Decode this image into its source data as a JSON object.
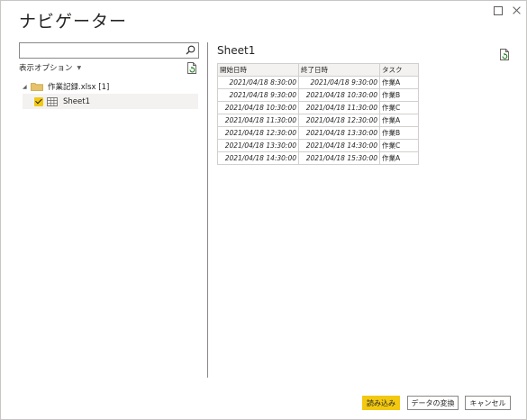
{
  "window": {
    "title": "ナビゲーター"
  },
  "left_pane": {
    "search": {
      "value": "",
      "placeholder": ""
    },
    "display_options_label": "表示オプション",
    "tree": {
      "root_label": "作業記録.xlsx [1]",
      "items": [
        {
          "label": "Sheet1",
          "checked": true,
          "selected": true
        }
      ]
    }
  },
  "preview": {
    "title": "Sheet1",
    "columns": [
      "開始日時",
      "終了日時",
      "タスク"
    ],
    "rows": [
      [
        "2021/04/18 8:30:00",
        "2021/04/18 9:30:00",
        "作業A"
      ],
      [
        "2021/04/18 9:30:00",
        "2021/04/18 10:30:00",
        "作業B"
      ],
      [
        "2021/04/18 10:30:00",
        "2021/04/18 11:30:00",
        "作業C"
      ],
      [
        "2021/04/18 11:30:00",
        "2021/04/18 12:30:00",
        "作業A"
      ],
      [
        "2021/04/18 12:30:00",
        "2021/04/18 13:30:00",
        "作業B"
      ],
      [
        "2021/04/18 13:30:00",
        "2021/04/18 14:30:00",
        "作業C"
      ],
      [
        "2021/04/18 14:30:00",
        "2021/04/18 15:30:00",
        "作業A"
      ]
    ]
  },
  "footer": {
    "load_label": "読み込み",
    "transform_label": "データの変換",
    "cancel_label": "キャンセル"
  },
  "colors": {
    "accent": "#f2c811",
    "border": "#8a8886",
    "selection": "#f3f2f1"
  }
}
